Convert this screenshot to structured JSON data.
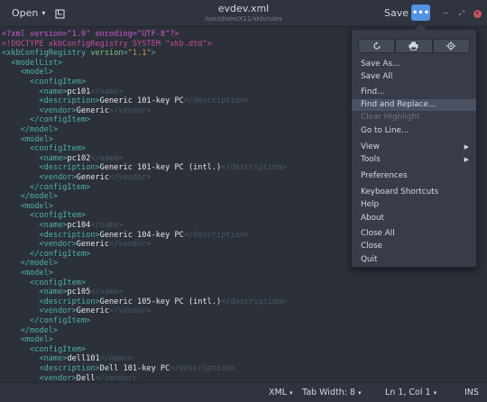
{
  "header": {
    "open_label": "Open",
    "title": "evdev.xml",
    "subtitle": "/usr/share/X11/xkb/rules",
    "save_label": "Save",
    "menu_glyph": "•••"
  },
  "editor": {
    "lines": [
      [
        {
          "t": "<?xml version=\"1.0\" encoding=\"UTF-8\"?>",
          "c": "pi"
        }
      ],
      [
        {
          "t": "<!DOCTYPE xkbConfigRegistry SYSTEM \"xkb.dtd\">",
          "c": "doctype"
        }
      ],
      [
        {
          "t": "<",
          "c": "tag"
        },
        {
          "t": "xkbConfigRegistry",
          "c": "tag"
        },
        {
          "t": " version",
          "c": "attr"
        },
        {
          "t": "=",
          "c": "tag"
        },
        {
          "t": "\"1.1\"",
          "c": "str"
        },
        {
          "t": ">",
          "c": "tag"
        }
      ],
      [
        {
          "t": "  <modelList>",
          "c": "tag"
        }
      ],
      [
        {
          "t": "    <model>",
          "c": "tag"
        }
      ],
      [
        {
          "t": "      <configItem>",
          "c": "tag"
        }
      ],
      [
        {
          "t": "        <name>",
          "c": "tag"
        },
        {
          "t": "pc101",
          "c": "text"
        },
        {
          "t": "</name>",
          "c": "dim"
        }
      ],
      [
        {
          "t": "        <description>",
          "c": "tag"
        },
        {
          "t": "Generic 101-key PC",
          "c": "text"
        },
        {
          "t": "</description>",
          "c": "dim"
        }
      ],
      [
        {
          "t": "        <vendor>",
          "c": "tag"
        },
        {
          "t": "Generic",
          "c": "text"
        },
        {
          "t": "</vendor>",
          "c": "dim"
        }
      ],
      [
        {
          "t": "      </configItem>",
          "c": "tag"
        }
      ],
      [
        {
          "t": "    </model>",
          "c": "tag"
        }
      ],
      [
        {
          "t": "    <model>",
          "c": "tag"
        }
      ],
      [
        {
          "t": "      <configItem>",
          "c": "tag"
        }
      ],
      [
        {
          "t": "        <name>",
          "c": "tag"
        },
        {
          "t": "pc102",
          "c": "text"
        },
        {
          "t": "</name>",
          "c": "dim"
        }
      ],
      [
        {
          "t": "        <description>",
          "c": "tag"
        },
        {
          "t": "Generic 101-key PC (intl.)",
          "c": "text"
        },
        {
          "t": "</description>",
          "c": "dim"
        }
      ],
      [
        {
          "t": "        <vendor>",
          "c": "tag"
        },
        {
          "t": "Generic",
          "c": "text"
        },
        {
          "t": "</vendor>",
          "c": "dim"
        }
      ],
      [
        {
          "t": "      </configItem>",
          "c": "tag"
        }
      ],
      [
        {
          "t": "    </model>",
          "c": "tag"
        }
      ],
      [
        {
          "t": "    <model>",
          "c": "tag"
        }
      ],
      [
        {
          "t": "      <configItem>",
          "c": "tag"
        }
      ],
      [
        {
          "t": "        <name>",
          "c": "tag"
        },
        {
          "t": "pc104",
          "c": "text"
        },
        {
          "t": "</name>",
          "c": "dim"
        }
      ],
      [
        {
          "t": "        <description>",
          "c": "tag"
        },
        {
          "t": "Generic 104-key PC",
          "c": "text"
        },
        {
          "t": "</description>",
          "c": "dim"
        }
      ],
      [
        {
          "t": "        <vendor>",
          "c": "tag"
        },
        {
          "t": "Generic",
          "c": "text"
        },
        {
          "t": "</vendor>",
          "c": "dim"
        }
      ],
      [
        {
          "t": "      </configItem>",
          "c": "tag"
        }
      ],
      [
        {
          "t": "    </model>",
          "c": "tag"
        }
      ],
      [
        {
          "t": "    <model>",
          "c": "tag"
        }
      ],
      [
        {
          "t": "      <configItem>",
          "c": "tag"
        }
      ],
      [
        {
          "t": "        <name>",
          "c": "tag"
        },
        {
          "t": "pc105",
          "c": "text"
        },
        {
          "t": "</name>",
          "c": "dim"
        }
      ],
      [
        {
          "t": "        <description>",
          "c": "tag"
        },
        {
          "t": "Generic 105-key PC (intl.)",
          "c": "text"
        },
        {
          "t": "</description>",
          "c": "dim"
        }
      ],
      [
        {
          "t": "        <vendor>",
          "c": "tag"
        },
        {
          "t": "Generic",
          "c": "text"
        },
        {
          "t": "</vendor>",
          "c": "dim"
        }
      ],
      [
        {
          "t": "      </configItem>",
          "c": "tag"
        }
      ],
      [
        {
          "t": "    </model>",
          "c": "tag"
        }
      ],
      [
        {
          "t": "    <model>",
          "c": "tag"
        }
      ],
      [
        {
          "t": "      <configItem>",
          "c": "tag"
        }
      ],
      [
        {
          "t": "        <name>",
          "c": "tag"
        },
        {
          "t": "dell101",
          "c": "text"
        },
        {
          "t": "</name>",
          "c": "dim"
        }
      ],
      [
        {
          "t": "        <description>",
          "c": "tag"
        },
        {
          "t": "Dell 101-key PC",
          "c": "text"
        },
        {
          "t": "</description>",
          "c": "dim"
        }
      ],
      [
        {
          "t": "        <vendor>",
          "c": "tag"
        },
        {
          "t": "Dell",
          "c": "text"
        },
        {
          "t": "</vendor>",
          "c": "dim"
        }
      ]
    ]
  },
  "popover": {
    "icons": [
      "refresh-icon",
      "print-icon",
      "goto-target-icon"
    ],
    "items": [
      {
        "label": "Save As...",
        "state": "normal"
      },
      {
        "label": "Save All",
        "state": "normal"
      },
      {
        "label": "Find...",
        "state": "normal"
      },
      {
        "label": "Find and Replace...",
        "state": "highlighted"
      },
      {
        "label": "Clear Highlight",
        "state": "disabled"
      },
      {
        "label": "Go to Line...",
        "state": "normal"
      },
      {
        "label": "View",
        "state": "normal",
        "submenu": true
      },
      {
        "label": "Tools",
        "state": "normal",
        "submenu": true
      },
      {
        "label": "Preferences",
        "state": "normal"
      },
      {
        "label": "Keyboard Shortcuts",
        "state": "normal"
      },
      {
        "label": "Help",
        "state": "normal"
      },
      {
        "label": "About",
        "state": "normal"
      },
      {
        "label": "Close All",
        "state": "normal"
      },
      {
        "label": "Close",
        "state": "normal"
      },
      {
        "label": "Quit",
        "state": "normal"
      }
    ]
  },
  "statusbar": {
    "language": "XML",
    "tab_width": "Tab Width: 8",
    "position": "Ln 1, Col 1",
    "mode": "INS"
  },
  "colors": {
    "accent": "#5294e2",
    "background": "#2b3039",
    "headerbar": "#2f343f",
    "popover": "#383c4a"
  }
}
